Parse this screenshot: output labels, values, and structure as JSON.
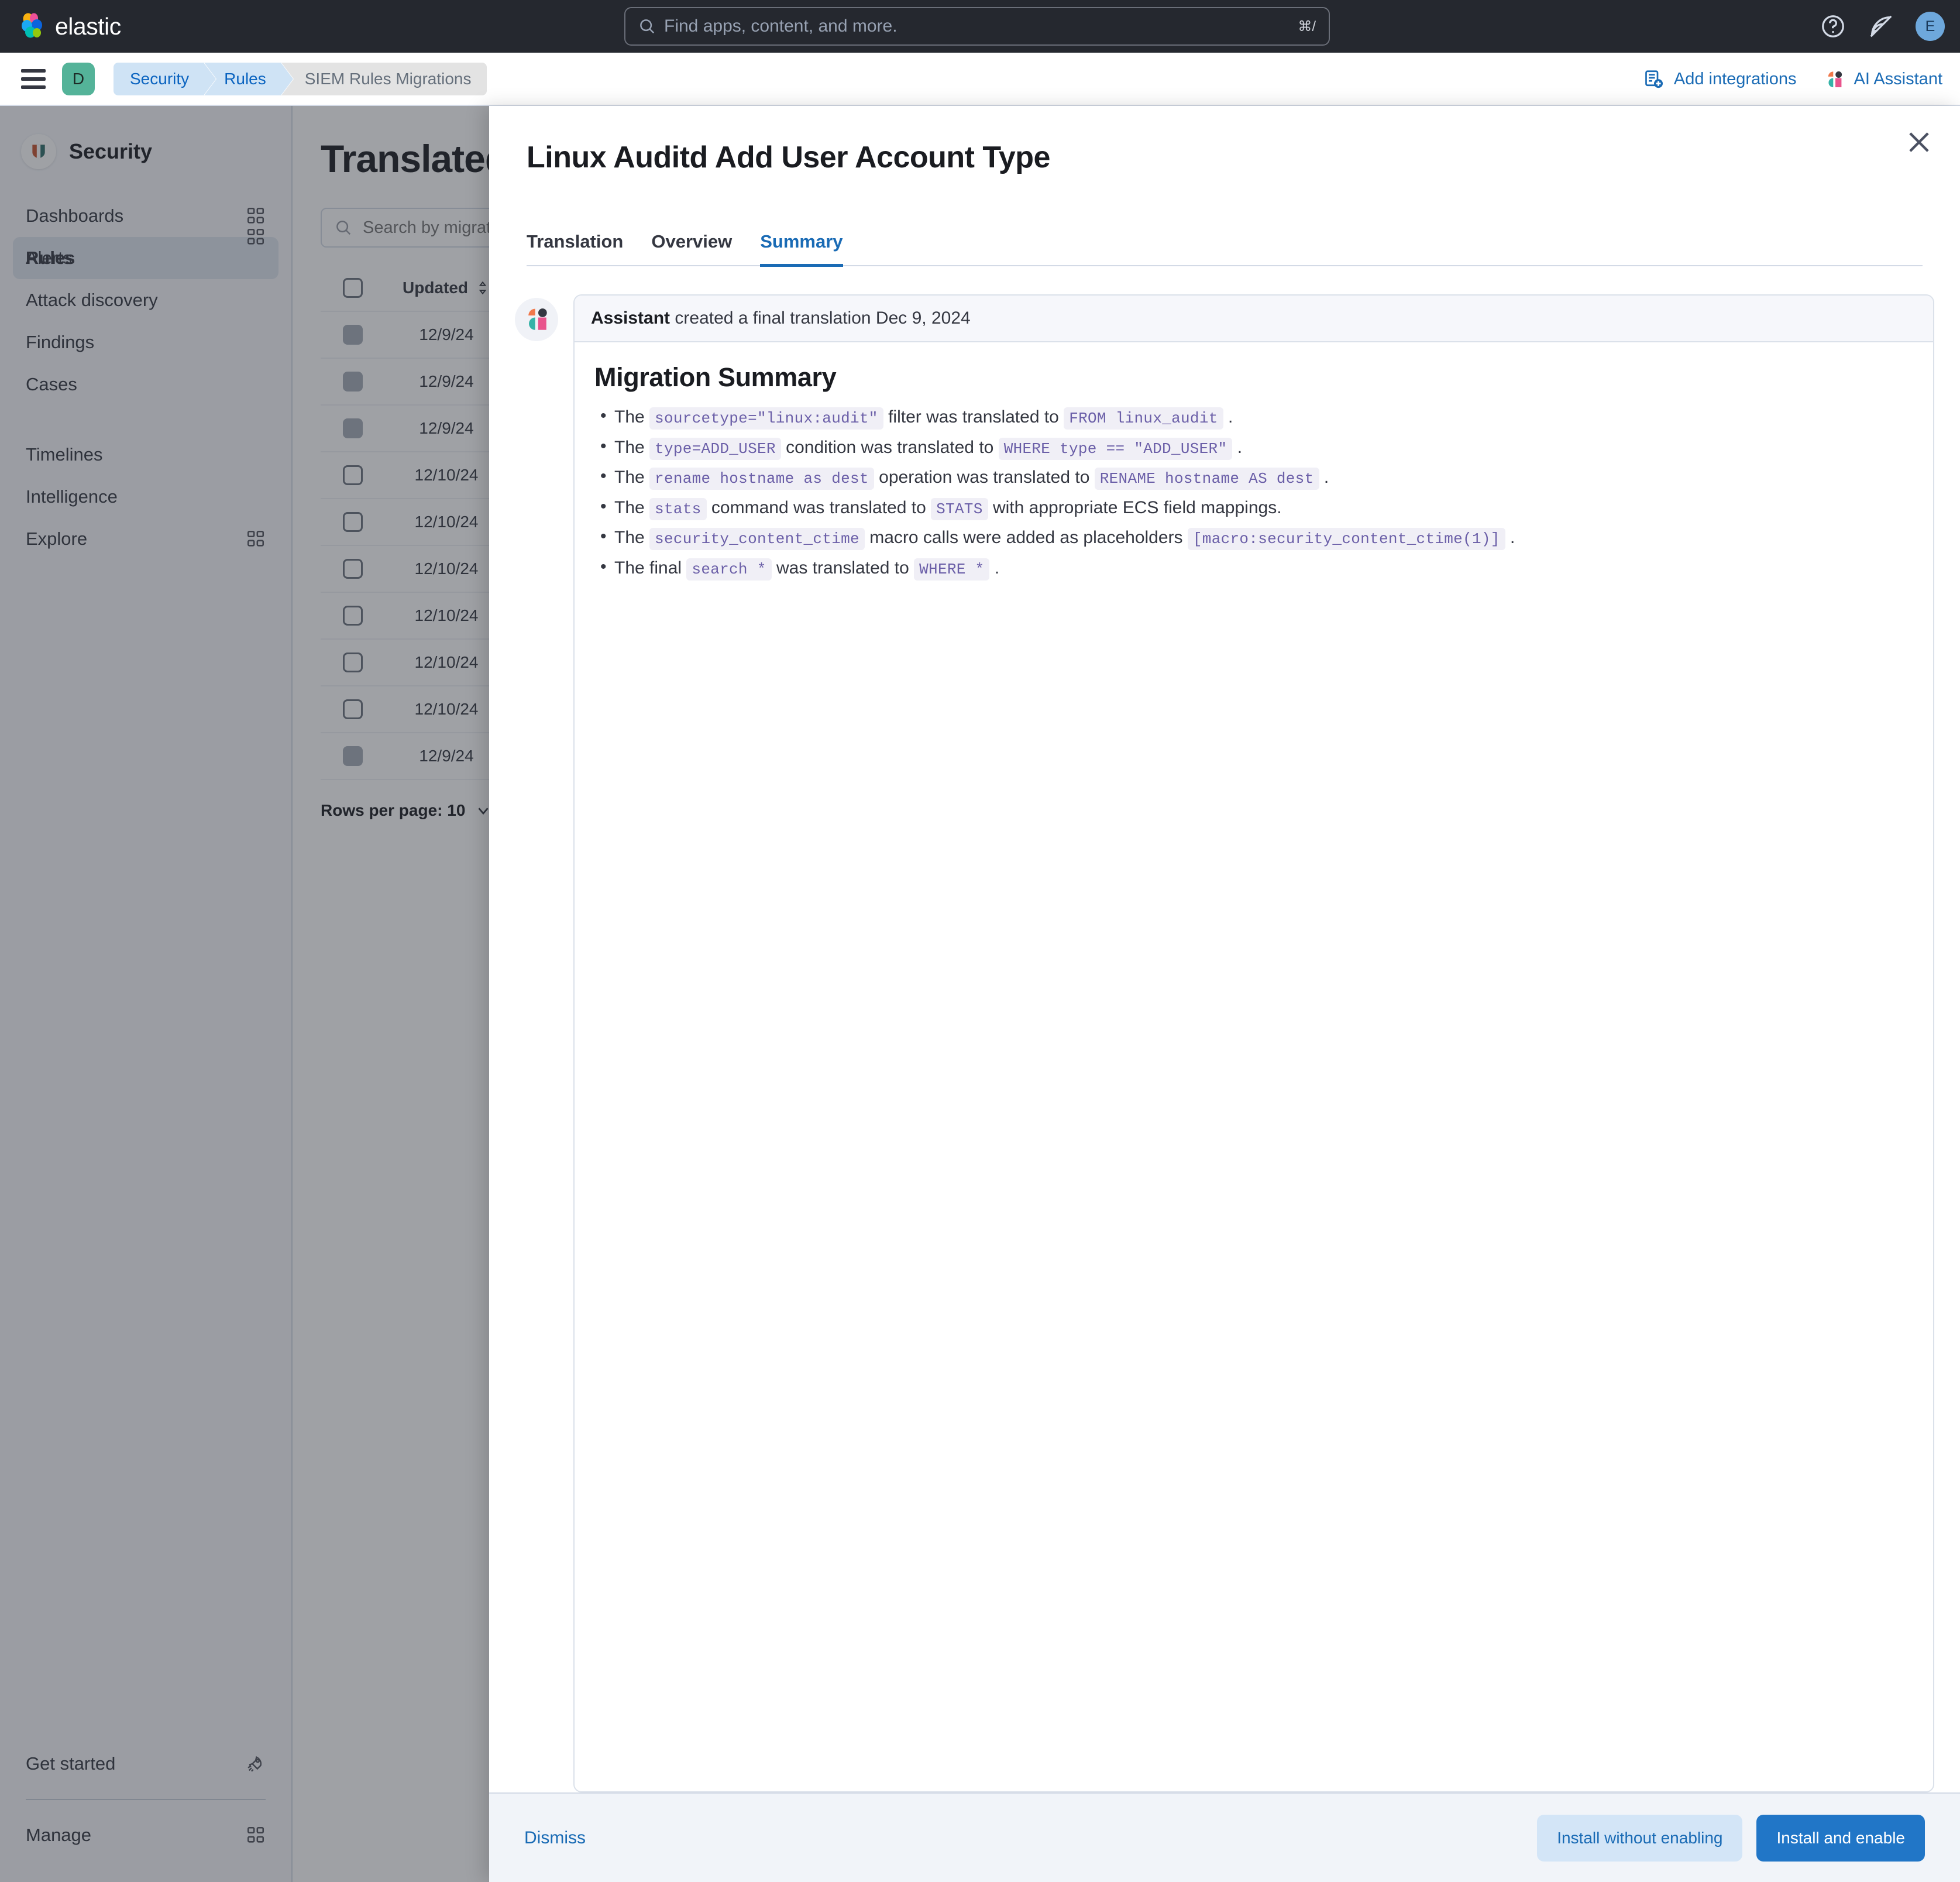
{
  "topbar": {
    "brand": "elastic",
    "search": {
      "placeholder": "Find apps, content, and more.",
      "shortcut": "⌘/"
    },
    "help_icon": "help-circle-icon",
    "notifications_icon": "news-feed-icon",
    "avatar_initial": "E"
  },
  "breadcrumbbar": {
    "menu_icon": "hamburger-menu-icon",
    "space_initial": "D",
    "crumbs": [
      {
        "label": "Security",
        "type": "link"
      },
      {
        "label": "Rules",
        "type": "link"
      },
      {
        "label": "SIEM Rules Migrations",
        "type": "current"
      }
    ],
    "actions": [
      {
        "label": "Add integrations",
        "icon": "add-integrations-icon"
      },
      {
        "label": "AI Assistant",
        "icon": "elastic-ai-assistant-icon"
      }
    ]
  },
  "sidebar": {
    "title": "Security",
    "brand_icon": "security-shield-icon",
    "items": [
      {
        "label": "Dashboards",
        "icon": "grid-panels-icon",
        "active": false
      },
      {
        "label": "Rules",
        "icon": "grid-panels-icon",
        "active": true
      },
      {
        "label": "Alerts",
        "icon": "",
        "active": false
      },
      {
        "label": "Attack discovery",
        "icon": "",
        "active": false
      },
      {
        "label": "Findings",
        "icon": "",
        "active": false
      },
      {
        "label": "Cases",
        "icon": "",
        "active": false
      },
      {
        "label": "Timelines",
        "icon": "",
        "active": false
      },
      {
        "label": "Intelligence",
        "icon": "",
        "active": false
      },
      {
        "label": "Explore",
        "icon": "grid-panels-icon",
        "active": false
      }
    ],
    "bottom_items": [
      {
        "label": "Get started",
        "icon": "rocket-icon"
      },
      {
        "label": "Manage",
        "icon": "grid-panels-icon"
      }
    ]
  },
  "main": {
    "page_title": "Translated",
    "search_placeholder": "Search by migration rule name",
    "table": {
      "columns": [
        "",
        "Updated"
      ],
      "sort_icon": "sort-arrows-icon",
      "rows": [
        {
          "updated": "12/9/24",
          "checkbox": "disabled"
        },
        {
          "updated": "12/9/24",
          "checkbox": "disabled"
        },
        {
          "updated": "12/9/24",
          "checkbox": "disabled"
        },
        {
          "updated": "12/10/24",
          "checkbox": "enabled"
        },
        {
          "updated": "12/10/24",
          "checkbox": "enabled"
        },
        {
          "updated": "12/10/24",
          "checkbox": "enabled"
        },
        {
          "updated": "12/10/24",
          "checkbox": "enabled"
        },
        {
          "updated": "12/10/24",
          "checkbox": "enabled"
        },
        {
          "updated": "12/10/24",
          "checkbox": "enabled"
        },
        {
          "updated": "12/9/24",
          "checkbox": "disabled"
        }
      ]
    },
    "rows_per_page_label": "Rows per page: 10"
  },
  "flyout": {
    "title": "Linux Auditd Add User Account Type",
    "close_icon": "close-icon",
    "tabs": [
      {
        "label": "Translation",
        "active": false
      },
      {
        "label": "Overview",
        "active": false
      },
      {
        "label": "Summary",
        "active": true
      }
    ],
    "assistant_avatar_icon": "elastic-ai-assistant-icon",
    "card_header": {
      "author": "Assistant",
      "text": "created a final translation Dec 9, 2024"
    },
    "summary_heading": "Migration Summary",
    "bullets": [
      {
        "pre": "The",
        "code1": "sourcetype=\"linux:audit\"",
        "mid": "filter was translated to",
        "code2": "FROM linux_audit",
        "post": "."
      },
      {
        "pre": "The",
        "code1": "type=ADD_USER",
        "mid": "condition was translated to",
        "code2": "WHERE type == \"ADD_USER\"",
        "post": "."
      },
      {
        "pre": "The",
        "code1": "rename hostname as dest",
        "mid": "operation was translated to",
        "code2": "RENAME hostname AS dest",
        "post": "."
      },
      {
        "pre": "The",
        "code1": "stats",
        "mid": "command was translated to",
        "code2": "STATS",
        "post": "with appropriate ECS field mappings."
      },
      {
        "pre": "The",
        "code1": "security_content_ctime",
        "mid": "macro calls were added as placeholders",
        "code2": "[macro:security_content_ctime(1)]",
        "post": "."
      },
      {
        "pre": "The final",
        "code1": "search *",
        "mid": "was translated to",
        "code2": "WHERE *",
        "post": "."
      }
    ],
    "footer": {
      "dismiss_label": "Dismiss",
      "secondary_label": "Install without enabling",
      "primary_label": "Install and enable"
    }
  },
  "colors": {
    "accent_blue": "#1a6bb5",
    "primary_button": "#2176c7",
    "topbar_bg": "#25282f",
    "space_badge": "#54b399",
    "code_text": "#6b5fa8",
    "code_bg": "#f0eff6"
  }
}
